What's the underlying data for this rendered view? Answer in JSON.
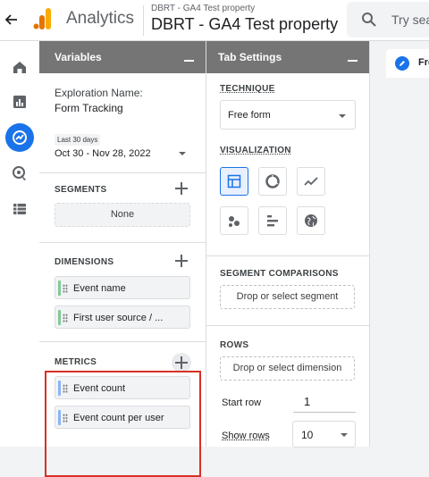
{
  "header": {
    "product_name": "Analytics",
    "account_path": "DBRT - GA4 Test property",
    "property_name": "DBRT - GA4 Test property",
    "search_placeholder": "Try sea"
  },
  "rail": {
    "items": [
      "home-icon",
      "reports-icon",
      "explore-icon",
      "advertising-icon",
      "configure-icon"
    ],
    "active": "explore-icon"
  },
  "variables_panel": {
    "title": "Variables",
    "exploration_name_label": "Exploration Name:",
    "exploration_name_value": "Form Tracking",
    "date_range_badge": "Last 30 days",
    "date_range_value": "Oct 30 - Nov 28, 2022",
    "segments": {
      "label": "SEGMENTS",
      "items": [
        "None"
      ]
    },
    "dimensions": {
      "label": "DIMENSIONS",
      "items": [
        "Event name",
        "First user source / ..."
      ]
    },
    "metrics": {
      "label": "METRICS",
      "items": [
        "Event count",
        "Event count per user"
      ]
    }
  },
  "tab_settings": {
    "title": "Tab Settings",
    "technique": {
      "label": "TECHNIQUE",
      "value": "Free form"
    },
    "visualization": {
      "label": "VISUALIZATION",
      "options": [
        "table-icon",
        "donut-chart-icon",
        "line-chart-icon",
        "scatter-plot-icon",
        "bar-chart-icon",
        "geo-map-icon"
      ],
      "selected": "table-icon"
    },
    "segment_comparisons": {
      "label": "SEGMENT COMPARISONS",
      "drop_text": "Drop or select segment"
    },
    "rows": {
      "label": "ROWS",
      "drop_text": "Drop or select dimension",
      "start_row_label": "Start row",
      "start_row_value": "1",
      "show_rows_label": "Show rows",
      "show_rows_value": "10"
    }
  },
  "canvas": {
    "tab_label": "Fre"
  },
  "colors": {
    "accent": "#1a73e8",
    "dimension_grip": "#81c995",
    "metric_grip": "#8ab4f8",
    "highlight": "#d93025",
    "panel_header": "#757575"
  }
}
